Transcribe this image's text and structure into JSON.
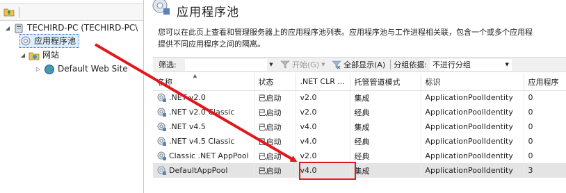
{
  "tree": {
    "server_label": "TECHIRD-PC (TECHIRD-PC\\",
    "pools_label": "应用程序池",
    "sites_label": "网站",
    "default_site_label": "Default Web Site"
  },
  "header": {
    "title": "应用程序池",
    "description_line1": "您可以在此页上查看和管理服务器上的应用程序池列表。应用程序池与工作进程相关联，包含一个或多个应用程",
    "description_line2": "提供不同应用程序之间的隔离。"
  },
  "toolbar": {
    "filter_label": "筛选:",
    "filter_value": "",
    "start_label": "开始(G)",
    "showall_label": "全部显示(A)",
    "groupby_label": "分组依据:",
    "groupby_value": "不进行分组"
  },
  "table": {
    "columns": [
      "名称",
      "状态",
      ".NET CLR ...",
      "托管管道模式",
      "标识",
      "应用程序"
    ],
    "rows": [
      {
        "name": ".NET v2.0",
        "status": "已启动",
        "clr": "v2.0",
        "pipeline": "集成",
        "identity": "ApplicationPoolIdentity",
        "apps": "0"
      },
      {
        "name": ".NET v2.0 Classic",
        "status": "已启动",
        "clr": "v2.0",
        "pipeline": "经典",
        "identity": "ApplicationPoolIdentity",
        "apps": "0"
      },
      {
        "name": ".NET v4.5",
        "status": "已启动",
        "clr": "v4.0",
        "pipeline": "集成",
        "identity": "ApplicationPoolIdentity",
        "apps": "0"
      },
      {
        "name": ".NET v4.5 Classic",
        "status": "已启动",
        "clr": "v4.0",
        "pipeline": "经典",
        "identity": "ApplicationPoolIdentity",
        "apps": "0"
      },
      {
        "name": "Classic .NET AppPool",
        "status": "已启动",
        "clr": "v2.0",
        "pipeline": "经典",
        "identity": "ApplicationPoolIdentity",
        "apps": "0"
      },
      {
        "name": "DefaultAppPool",
        "status": "已启动",
        "clr": "v4.0",
        "pipeline": "集成",
        "identity": "ApplicationPoolIdentity",
        "apps": "3"
      }
    ],
    "selected_row": 5
  },
  "icons": {
    "server": "server-icon",
    "app_pools": "app-pools-icon",
    "sites": "sites-folder-icon",
    "website": "globe-icon",
    "pool": "app-pool-icon",
    "filter": "funnel-icon",
    "show_all": "show-all-icon"
  },
  "colors": {
    "annotation": "#e3171b",
    "selection": "#ddeeff",
    "selected_row": "#e4e4e4"
  }
}
